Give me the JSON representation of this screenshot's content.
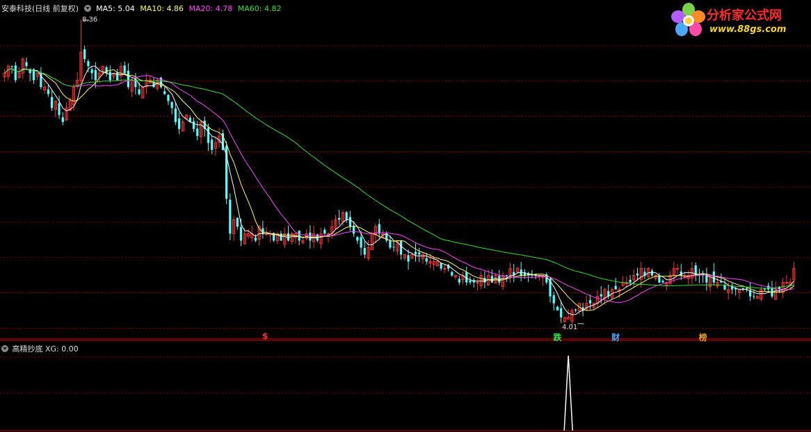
{
  "header": {
    "stock": "安泰科技(日线 前复权)",
    "ma5_label": "MA5: 5.04",
    "ma10_label": "MA10: 4.86",
    "ma20_label": "MA20: 4.78",
    "ma60_label": "MA60: 4.82"
  },
  "sub_header": {
    "indicator": "高精抄底",
    "xg_label": "XG: 0.00"
  },
  "annotations": {
    "high_price": "8.36",
    "low_price": "4.01"
  },
  "signals": [
    {
      "label": "$",
      "color": "#ff3030",
      "x_index": 72
    },
    {
      "label": "跌",
      "color": "#2ee84a",
      "x_index": 152
    },
    {
      "label": "财",
      "color": "#4aa8ff",
      "x_index": 168
    },
    {
      "label": "榜",
      "color": "#e8a020",
      "x_index": 192
    }
  ],
  "logo": {
    "text": "分析家公式网",
    "url": "www.88gs.com"
  },
  "colors": {
    "up": "#ff3232",
    "down": "#54ffff",
    "ma5": "#ffffff",
    "ma10": "#ffff66",
    "ma20": "#ff44ff",
    "ma60": "#33dd33",
    "grid": "#8b0000",
    "xg": "#ffffff"
  },
  "chart_data": {
    "type": "candlestick",
    "price_range": [
      4.01,
      8.36
    ],
    "high_annotation_index": 21,
    "low_annotation_index": 157,
    "closes": [
      7.6,
      7.7,
      7.7,
      7.5,
      7.6,
      7.8,
      7.7,
      7.6,
      7.5,
      7.6,
      7.4,
      7.4,
      7.3,
      7.1,
      7.2,
      7.0,
      6.9,
      7.1,
      7.2,
      7.4,
      7.5,
      7.9,
      7.8,
      7.7,
      7.6,
      7.5,
      7.6,
      7.7,
      7.6,
      7.5,
      7.6,
      7.5,
      7.7,
      7.6,
      7.4,
      7.5,
      7.4,
      7.3,
      7.4,
      7.5,
      7.5,
      7.4,
      7.5,
      7.4,
      7.3,
      7.2,
      7.1,
      6.9,
      6.8,
      6.9,
      7.0,
      6.9,
      6.8,
      6.7,
      6.9,
      6.8,
      6.6,
      6.5,
      6.6,
      6.7,
      6.5,
      5.8,
      5.3,
      5.5,
      5.4,
      5.2,
      5.3,
      5.3,
      5.3,
      5.2,
      5.4,
      5.3,
      5.3,
      5.3,
      5.2,
      5.3,
      5.2,
      5.3,
      5.2,
      5.3,
      5.3,
      5.2,
      5.2,
      5.3,
      5.2,
      5.3,
      5.2,
      5.3,
      5.3,
      5.3,
      5.4,
      5.5,
      5.5,
      5.6,
      5.5,
      5.4,
      5.3,
      5.2,
      5.1,
      5.0,
      5.1,
      5.3,
      5.4,
      5.3,
      5.3,
      5.2,
      5.1,
      5.1,
      5.2,
      5.0,
      5.0,
      4.9,
      5.0,
      5.0,
      5.0,
      5.0,
      4.9,
      4.9,
      4.9,
      4.9,
      4.8,
      4.8,
      4.8,
      4.7,
      4.7,
      4.6,
      4.7,
      4.6,
      4.6,
      4.6,
      4.6,
      4.7,
      4.6,
      4.7,
      4.6,
      4.7,
      4.6,
      4.7,
      4.7,
      4.8,
      4.7,
      4.8,
      4.7,
      4.7,
      4.7,
      4.7,
      4.7,
      4.7,
      4.7,
      4.6,
      4.4,
      4.3,
      4.2,
      4.1,
      4.1,
      4.1,
      4.2,
      4.2,
      4.3,
      4.2,
      4.3,
      4.3,
      4.3,
      4.4,
      4.4,
      4.5,
      4.4,
      4.5,
      4.5,
      4.5,
      4.6,
      4.6,
      4.6,
      4.7,
      4.7,
      4.8,
      4.7,
      4.8,
      4.7,
      4.7,
      4.6,
      4.6,
      4.6,
      4.7,
      4.8,
      4.8,
      4.7,
      4.7,
      4.7,
      4.8,
      4.7,
      4.7,
      4.7,
      4.6,
      4.7,
      4.6,
      4.6,
      4.6,
      4.5,
      4.5,
      4.5,
      4.5,
      4.5,
      4.5,
      4.5,
      4.4,
      4.4,
      4.4,
      4.5,
      4.5,
      4.5,
      4.4,
      4.5,
      4.5,
      4.6,
      4.6,
      4.6,
      4.8
    ],
    "xg": {
      "peak_index": 155,
      "peak_value": 1,
      "values": "0 except at peak"
    }
  }
}
